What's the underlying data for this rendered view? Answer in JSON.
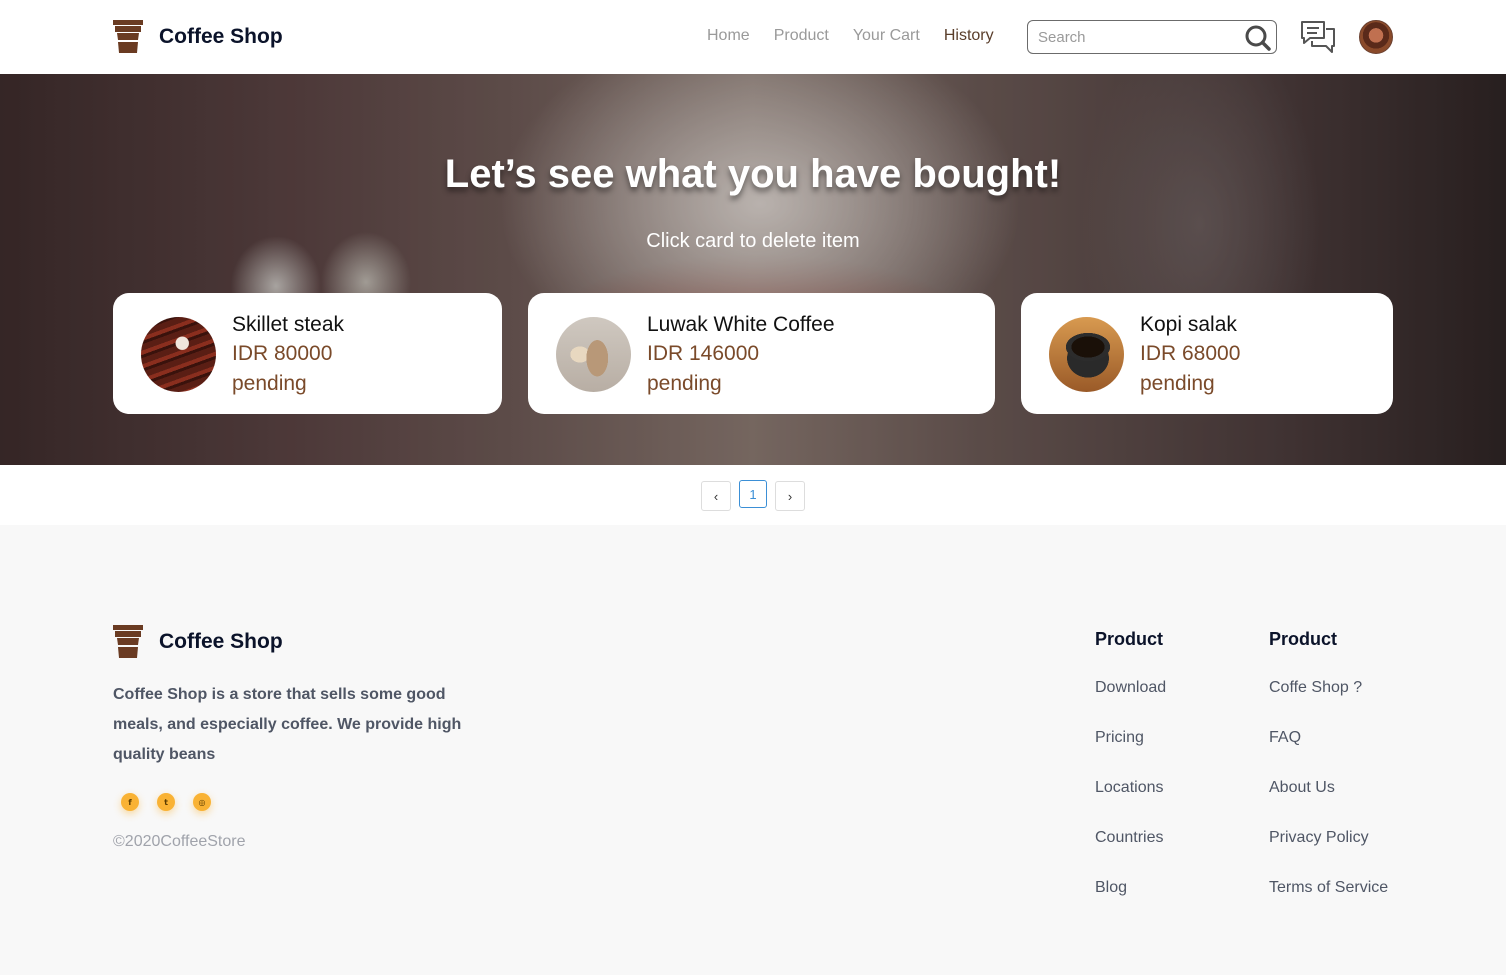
{
  "navbar": {
    "brand": "Coffee Shop",
    "links": [
      {
        "label": "Home",
        "active": false
      },
      {
        "label": "Product",
        "active": false
      },
      {
        "label": "Your Cart",
        "active": false
      },
      {
        "label": "History",
        "active": true
      }
    ],
    "search_placeholder": "Search",
    "search_value": "",
    "icons": [
      "search-icon",
      "chat-icon",
      "avatar"
    ]
  },
  "hero": {
    "title": "Let’s see what you have bought!",
    "subtitle": "Click card to delete item"
  },
  "history_cards": [
    {
      "name": "Skillet steak",
      "price": "IDR 80000",
      "status": "pending",
      "image": "steak"
    },
    {
      "name": "Luwak White Coffee",
      "price": "IDR 146000",
      "status": "pending",
      "image": "iced-coffee"
    },
    {
      "name": "Kopi salak",
      "price": "IDR 68000",
      "status": "pending",
      "image": "coffee-cup"
    }
  ],
  "pagination": {
    "prev": "‹",
    "current": "1",
    "next": "›"
  },
  "footer": {
    "brand": "Coffee Shop",
    "description": "Coffee Shop is a store that sells some good meals, and especially coffee. We provide high quality beans",
    "socials": [
      "facebook-icon",
      "twitter-icon",
      "instagram-icon"
    ],
    "social_glyphs": [
      "f",
      "t",
      "◎"
    ],
    "copyright": "©2020CoffeeStore",
    "columns": [
      {
        "title": "Product",
        "links": [
          "Download",
          "Pricing",
          "Locations",
          "Countries",
          "Blog"
        ]
      },
      {
        "title": "Product",
        "links": [
          "Coffe Shop ?",
          "FAQ",
          "About Us",
          "Privacy Policy",
          "Terms of Service"
        ]
      }
    ]
  },
  "colors": {
    "accent_brown": "#7a4a2a",
    "brand_dark": "#0b132a",
    "social_yellow": "#f9b234",
    "pagination_active": "#3b8fd6"
  }
}
